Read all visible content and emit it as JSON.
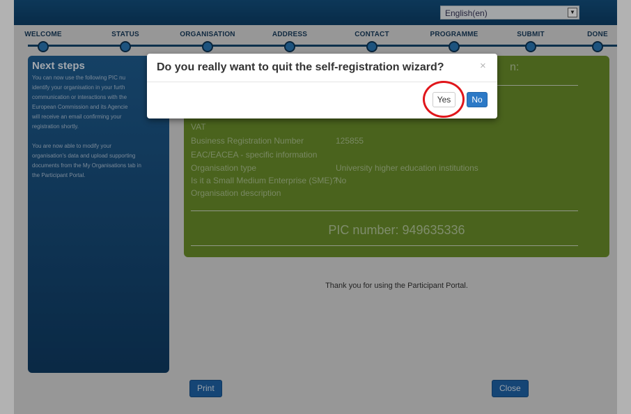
{
  "language": {
    "selected": "English(en)"
  },
  "steps": [
    {
      "label": "WELCOME"
    },
    {
      "label": "STATUS"
    },
    {
      "label": "ORGANISATION"
    },
    {
      "label": "ADDRESS"
    },
    {
      "label": "CONTACT"
    },
    {
      "label": "PROGRAMME"
    },
    {
      "label": "SUBMIT"
    },
    {
      "label": "DONE"
    }
  ],
  "sidebar": {
    "title": "Next steps",
    "paragraphs": [
      "You can now use the following PIC nu",
      "identify your organisation in your furth",
      "communication or interactions with the",
      "European Commission and its Agencie",
      "will receive an email confirming your",
      "registration shortly.",
      "",
      "You are now able to modify your",
      "organisation's data and upload supporting",
      "documents from the My Organisations tab in",
      "the Participant Portal."
    ]
  },
  "panel": {
    "heading": "n:",
    "fields": [
      {
        "label": "VAT",
        "value": ""
      },
      {
        "label": "Business Registration Number",
        "value": "125855"
      },
      {
        "label": "EAC/EACEA - specific information",
        "value": ""
      },
      {
        "label": "Organisation type",
        "value": "University higher education institutions"
      },
      {
        "label": "Is it a Small Medium Enterprise (SME)?",
        "value": "No"
      },
      {
        "label": "Organisation description",
        "value": ""
      }
    ],
    "pic": "PIC number: 949635336"
  },
  "thanks": "Thank you for using the Participant Portal.",
  "buttons": {
    "print": "Print",
    "close": "Close"
  },
  "dialog": {
    "title": "Do you really want to quit the self-registration wizard?",
    "close_glyph": "×",
    "yes": "Yes",
    "no": "No"
  }
}
